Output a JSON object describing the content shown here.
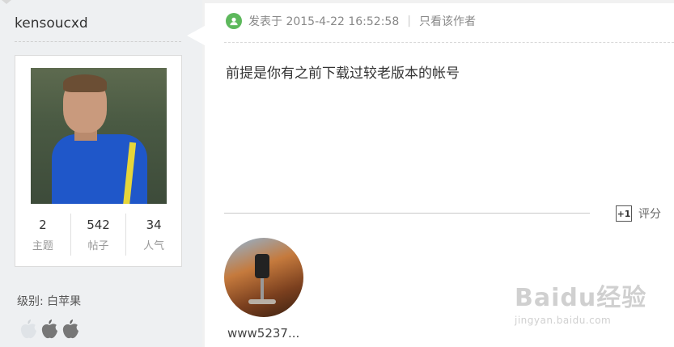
{
  "user": {
    "username": "kensoucxd",
    "stats": [
      {
        "value": "2",
        "label": "主题"
      },
      {
        "value": "542",
        "label": "帖子"
      },
      {
        "value": "34",
        "label": "人气"
      }
    ],
    "level": "级别: 白苹果"
  },
  "post": {
    "meta": {
      "posted": "发表于 2015-4-22 16:52:58",
      "separator": "|",
      "author_only": "只看该作者"
    },
    "body": "前提是你有之前下载过较老版本的帐号",
    "rate_label": "评分",
    "rate_icon_text": "+1"
  },
  "commenter": {
    "name": "www5237..."
  },
  "watermark": {
    "main": "Baidu经验",
    "sub": "jingyan.baidu.com"
  }
}
